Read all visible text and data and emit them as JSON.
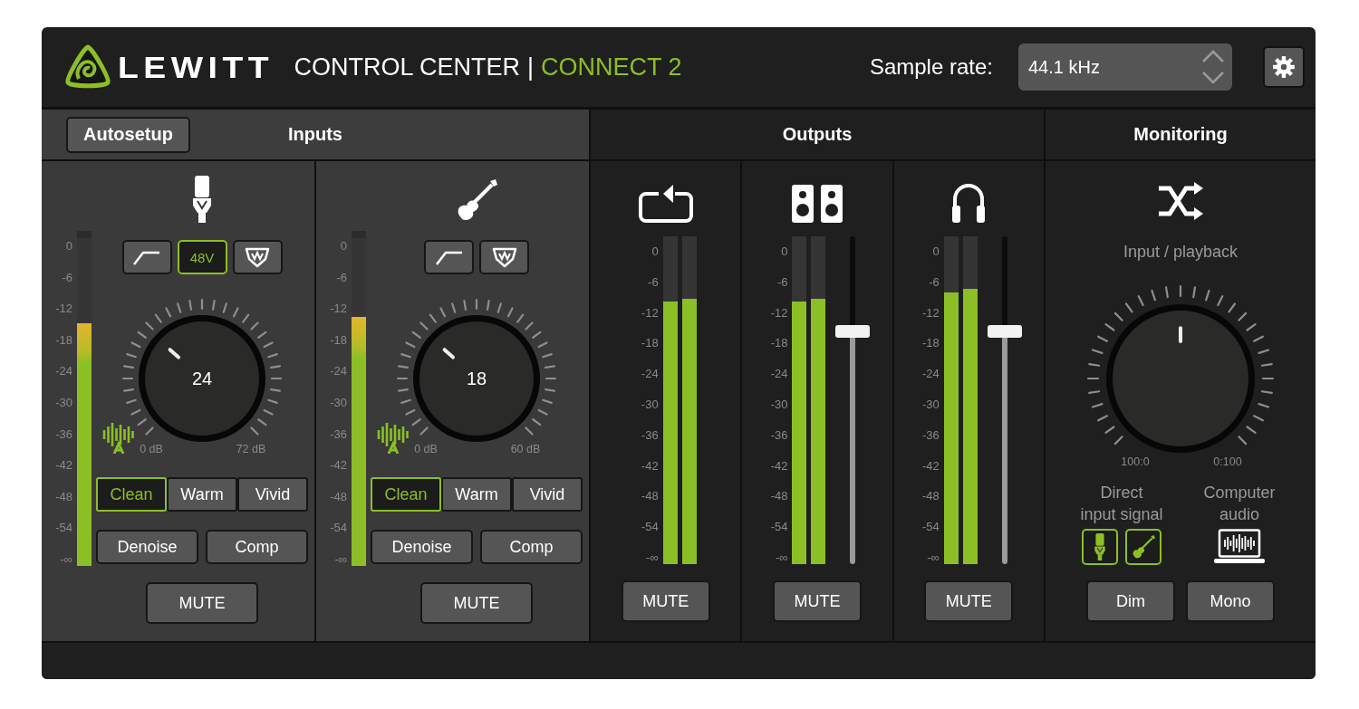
{
  "header": {
    "logo": "LEWITT",
    "title": "CONTROL CENTER",
    "separator": "|",
    "device": "CONNECT 2",
    "sample_rate_label": "Sample rate:",
    "sample_rate": "44.1 kHz"
  },
  "inputs": {
    "autosetup": "Autosetup",
    "title": "Inputs",
    "channels": [
      {
        "kind": "mic",
        "scale": [
          "0",
          "-6",
          "-12",
          "-18",
          "-24",
          "-30",
          "-36",
          "-42",
          "-48",
          "-54",
          "-∞"
        ],
        "meter": {
          "level": 0.74
        },
        "buttons": [
          {
            "kind": "lowcut",
            "on": false
          },
          {
            "kind": "phantom",
            "label": "48V",
            "on": true
          },
          {
            "kind": "clipguard",
            "on": false
          }
        ],
        "gain_knob": {
          "value": "24"
        },
        "gain_min": "0 dB",
        "gain_max": "72 dB",
        "voicings": [
          {
            "label": "Clean",
            "selected": true
          },
          {
            "label": "Warm",
            "selected": false
          },
          {
            "label": "Vivid",
            "selected": false
          }
        ],
        "effects": [
          {
            "label": "Denoise",
            "on": false
          },
          {
            "label": "Comp",
            "on": false
          }
        ],
        "mute": {
          "label": "MUTE",
          "on": false
        }
      },
      {
        "kind": "guitar",
        "scale": [
          "0",
          "-6",
          "-12",
          "-18",
          "-24",
          "-30",
          "-36",
          "-42",
          "-48",
          "-54",
          "-∞"
        ],
        "meter": {
          "level": 0.76
        },
        "buttons": [
          {
            "kind": "lowcut",
            "on": false
          },
          {
            "kind": "clipguard",
            "on": false
          }
        ],
        "gain_knob": {
          "value": "18"
        },
        "gain_min": "0 dB",
        "gain_max": "60 dB",
        "voicings": [
          {
            "label": "Clean",
            "selected": true
          },
          {
            "label": "Warm",
            "selected": false
          },
          {
            "label": "Vivid",
            "selected": false
          }
        ],
        "effects": [
          {
            "label": "Denoise",
            "on": false
          },
          {
            "label": "Comp",
            "on": false
          }
        ],
        "mute": {
          "label": "MUTE",
          "on": false
        }
      }
    ]
  },
  "outputs": {
    "title": "Outputs",
    "channels": [
      {
        "kind": "loopback",
        "scale": [
          "0",
          "-6",
          "-12",
          "-18",
          "-24",
          "-30",
          "-36",
          "-42",
          "-48",
          "-54",
          "-∞"
        ],
        "meters": [
          {
            "level": 0.8
          },
          {
            "level": 0.81
          }
        ],
        "mute": {
          "label": "MUTE",
          "on": false
        }
      },
      {
        "kind": "speakers",
        "scale": [
          "0",
          "-6",
          "-12",
          "-18",
          "-24",
          "-30",
          "-36",
          "-42",
          "-48",
          "-54",
          "-∞"
        ],
        "meters": [
          {
            "level": 0.8
          },
          {
            "level": 0.81
          }
        ],
        "fader": {
          "level": 0.71
        },
        "mute": {
          "label": "MUTE",
          "on": false
        }
      },
      {
        "kind": "headphones",
        "scale": [
          "0",
          "-6",
          "-12",
          "-18",
          "-24",
          "-30",
          "-36",
          "-42",
          "-48",
          "-54",
          "-∞"
        ],
        "meters": [
          {
            "level": 0.83
          },
          {
            "level": 0.84
          }
        ],
        "fader": {
          "level": 0.71
        },
        "mute": {
          "label": "MUTE",
          "on": false
        }
      }
    ]
  },
  "monitoring": {
    "title": "Monitoring",
    "mix_label": "Input / playback",
    "mix_min": "100:0",
    "mix_max": "0:100",
    "direct_label": "Direct\ninput signal",
    "computer_label": "Computer\naudio",
    "direct_sources": [
      {
        "kind": "mic",
        "on": true
      },
      {
        "kind": "guitar",
        "on": true
      }
    ],
    "buttons": [
      {
        "label": "Dim",
        "on": false
      },
      {
        "label": "Mono",
        "on": false
      }
    ]
  }
}
